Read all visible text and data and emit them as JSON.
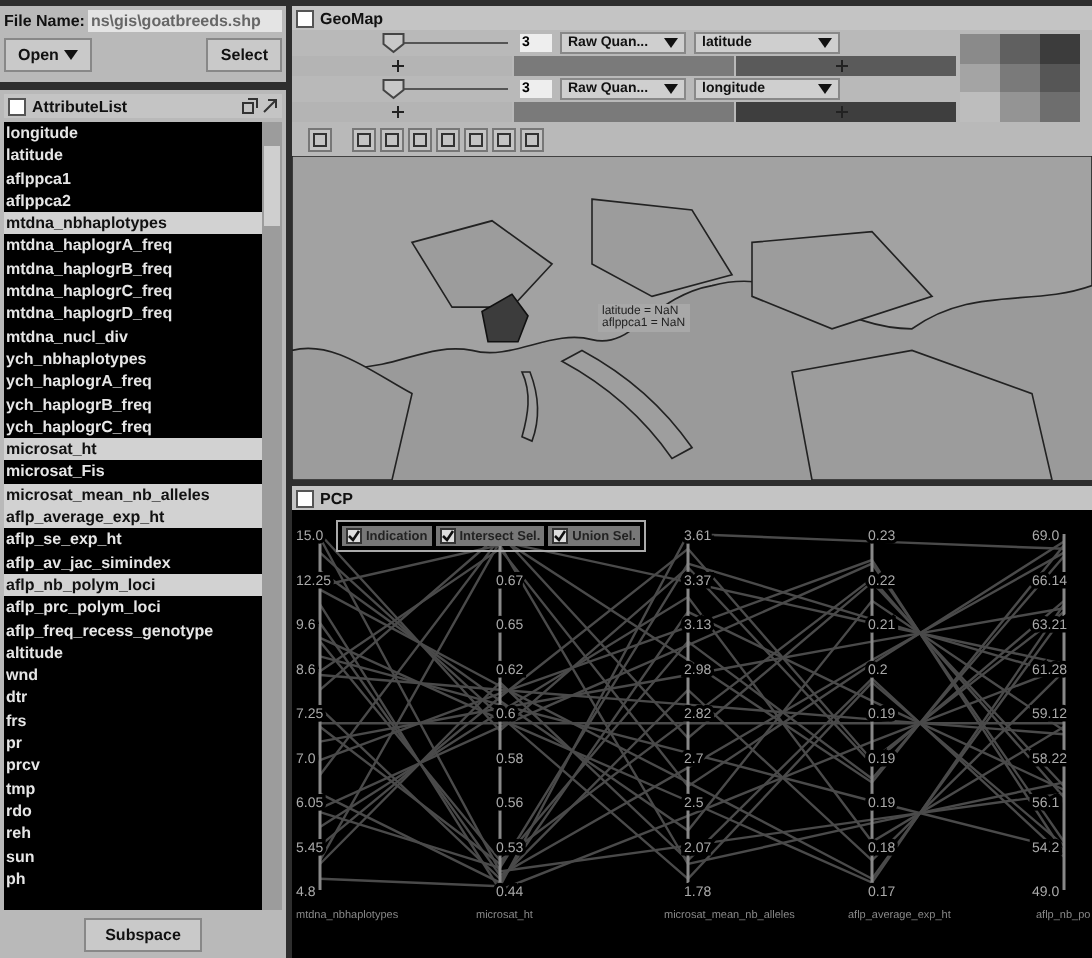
{
  "file_bar": {
    "label": "File Name:",
    "value": "ns\\gis\\goatbreeds.shp",
    "open_button": "Open",
    "select_button": "Select"
  },
  "attribute_list": {
    "title": "AttributeList",
    "items": [
      {
        "label": "longitude",
        "selected": false
      },
      {
        "label": "latitude",
        "selected": false
      },
      {
        "label": "aflppca1",
        "selected": false
      },
      {
        "label": "aflppca2",
        "selected": false
      },
      {
        "label": "mtdna_nbhaplotypes",
        "selected": true
      },
      {
        "label": "mtdna_haplogrA_freq",
        "selected": false
      },
      {
        "label": "mtdna_haplogrB_freq",
        "selected": false
      },
      {
        "label": "mtdna_haplogrC_freq",
        "selected": false
      },
      {
        "label": "mtdna_haplogrD_freq",
        "selected": false
      },
      {
        "label": "mtdna_nucl_div",
        "selected": false
      },
      {
        "label": "ych_nbhaplotypes",
        "selected": false
      },
      {
        "label": "ych_haplogrA_freq",
        "selected": false
      },
      {
        "label": "ych_haplogrB_freq",
        "selected": false
      },
      {
        "label": "ych_haplogrC_freq",
        "selected": false
      },
      {
        "label": "microsat_ht",
        "selected": true
      },
      {
        "label": "microsat_Fis",
        "selected": false
      },
      {
        "label": "microsat_mean_nb_alleles",
        "selected": true
      },
      {
        "label": "aflp_average_exp_ht",
        "selected": true
      },
      {
        "label": "aflp_se_exp_ht",
        "selected": false
      },
      {
        "label": "aflp_av_jac_simindex",
        "selected": false
      },
      {
        "label": "aflp_nb_polym_loci",
        "selected": true
      },
      {
        "label": "aflp_prc_polym_loci",
        "selected": false
      },
      {
        "label": "aflp_freq_recess_genotype",
        "selected": false
      },
      {
        "label": "altitude",
        "selected": false
      },
      {
        "label": "wnd",
        "selected": false
      },
      {
        "label": "dtr",
        "selected": false
      },
      {
        "label": "frs",
        "selected": false
      },
      {
        "label": "pr",
        "selected": false
      },
      {
        "label": "prcv",
        "selected": false
      },
      {
        "label": "tmp",
        "selected": false
      },
      {
        "label": "rdo",
        "selected": false
      },
      {
        "label": "reh",
        "selected": false
      },
      {
        "label": "sun",
        "selected": false
      },
      {
        "label": "ph",
        "selected": false
      }
    ],
    "button": "Subspace"
  },
  "geomap": {
    "title": "GeoMap",
    "variables": [
      {
        "level": 0.05,
        "value": "3",
        "classification": "Raw Quan...",
        "attribute": "latitude"
      },
      {
        "level": 0.05,
        "value": "3",
        "classification": "Raw Quan...",
        "attribute": "longitude"
      }
    ],
    "tooltip": [
      "latitude = NaN",
      "aflppca1 = NaN"
    ]
  },
  "pcp": {
    "title": "PCP",
    "toggles": [
      {
        "label": "Indication",
        "checked": true
      },
      {
        "label": "Intersect Sel.",
        "checked": true
      },
      {
        "label": "Union Sel.",
        "checked": true
      }
    ],
    "axes": [
      {
        "name": "mtdna_nbhaplotypes",
        "ticks": [
          "15.0",
          "12.25",
          "9.6",
          "8.6",
          "7.25",
          "7.0",
          "6.05",
          "5.45",
          "4.8"
        ]
      },
      {
        "name": "microsat_ht",
        "ticks": [
          "0.67",
          "0.65",
          "0.62",
          "0.6",
          "0.58",
          "0.56",
          "0.53",
          "0.44"
        ]
      },
      {
        "name": "microsat_mean_nb_alleles",
        "ticks": [
          "3.61",
          "3.37",
          "3.13",
          "2.98",
          "2.82",
          "2.7",
          "2.5",
          "2.07",
          "1.78"
        ]
      },
      {
        "name": "aflp_average_exp_ht",
        "ticks": [
          "0.23",
          "0.22",
          "0.21",
          "0.2",
          "0.19",
          "0.19",
          "0.19",
          "0.18",
          "0.17"
        ]
      },
      {
        "name": "aflp_nb_po",
        "ticks": [
          "69.0",
          "66.14",
          "63.21",
          "61.28",
          "59.12",
          "58.22",
          "56.1",
          "54.2",
          "49.0"
        ]
      }
    ]
  }
}
